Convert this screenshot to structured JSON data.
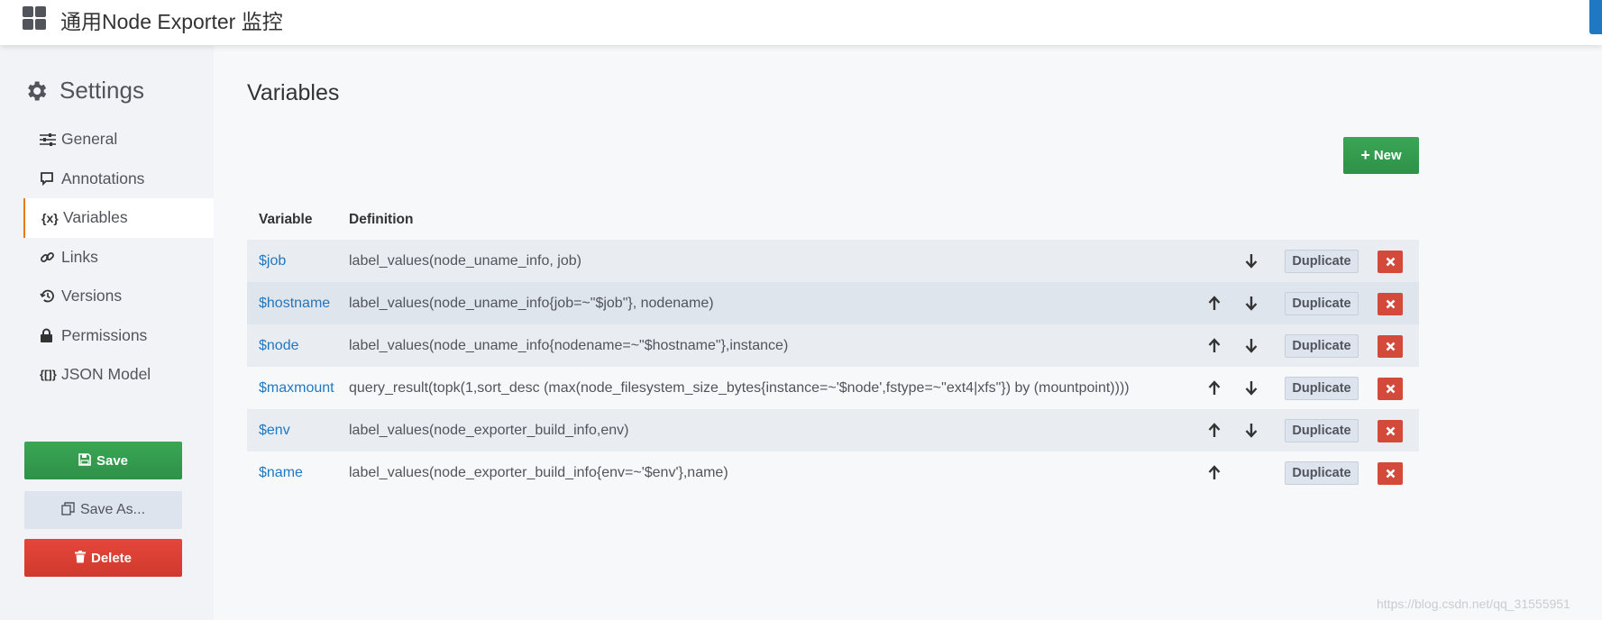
{
  "topbar": {
    "dashboard_title": "通用Node Exporter 监控"
  },
  "sidebar": {
    "heading": "Settings",
    "items": [
      {
        "label": "General",
        "icon": "sliders-icon"
      },
      {
        "label": "Annotations",
        "icon": "comment-icon"
      },
      {
        "label": "Variables",
        "icon": "variable-icon",
        "icon_text": "{x}",
        "active": true
      },
      {
        "label": "Links",
        "icon": "link-icon"
      },
      {
        "label": "Versions",
        "icon": "history-icon"
      },
      {
        "label": "Permissions",
        "icon": "lock-icon"
      },
      {
        "label": "JSON Model",
        "icon": "json-icon",
        "icon_text": "{[]}"
      }
    ],
    "save_label": "Save",
    "save_as_label": "Save As...",
    "delete_label": "Delete"
  },
  "main": {
    "title": "Variables",
    "new_button_label": "New",
    "table": {
      "headers": {
        "variable": "Variable",
        "definition": "Definition"
      },
      "rows": [
        {
          "name": "$job",
          "definition": "label_values(node_uname_info, job)"
        },
        {
          "name": "$hostname",
          "definition": "label_values(node_uname_info{job=~\"$job\"}, nodename)"
        },
        {
          "name": "$node",
          "definition": "label_values(node_uname_info{nodename=~\"$hostname\"},instance)"
        },
        {
          "name": "$maxmount",
          "definition": "query_result(topk(1,sort_desc (max(node_filesystem_size_bytes{instance=~'$node',fstype=~\"ext4|xfs\"}) by (mountpoint))))"
        },
        {
          "name": "$env",
          "definition": "label_values(node_exporter_build_info,env)"
        },
        {
          "name": "$name",
          "definition": "label_values(node_exporter_build_info{env=~'$env'},name)"
        }
      ],
      "duplicate_label": "Duplicate"
    }
  },
  "watermark": "https://blog.csdn.net/qq_31555951",
  "colors": {
    "accent_blue": "#1f78c1",
    "green": "#2e9148",
    "red": "#d44a3a",
    "active_border": "#eb7b18"
  }
}
